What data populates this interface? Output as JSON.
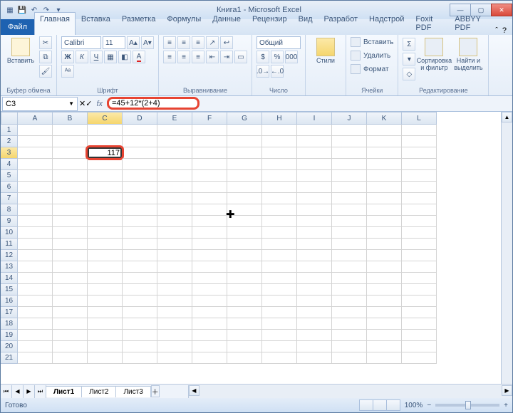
{
  "title": "Книга1 - Microsoft Excel",
  "tabs": {
    "file": "Файл",
    "items": [
      "Главная",
      "Вставка",
      "Разметка",
      "Формулы",
      "Данные",
      "Рецензир",
      "Вид",
      "Разработ",
      "Надстрой",
      "Foxit PDF",
      "ABBYY PDF"
    ],
    "activeIndex": 0
  },
  "ribbon": {
    "clipboard": {
      "paste": "Вставить",
      "label": "Буфер обмена"
    },
    "font": {
      "name": "Calibri",
      "size": "11",
      "label": "Шрифт"
    },
    "align": {
      "label": "Выравнивание"
    },
    "number": {
      "format": "Общий",
      "label": "Число"
    },
    "styles": {
      "btn": "Стили",
      "label": ""
    },
    "cells": {
      "insert": "Вставить",
      "delete": "Удалить",
      "format": "Формат",
      "label": "Ячейки"
    },
    "editing": {
      "sort": "Сортировка\nи фильтр",
      "find": "Найти и\nвыделить",
      "label": "Редактирование"
    }
  },
  "namebox": "C3",
  "formula": "=45+12*(2+4)",
  "active_cell_value": "117",
  "columns": [
    "A",
    "B",
    "C",
    "D",
    "E",
    "F",
    "G",
    "H",
    "I",
    "J",
    "K",
    "L"
  ],
  "selectedCol": "C",
  "selectedRow": 3,
  "rowCount": 21,
  "sheets": [
    "Лист1",
    "Лист2",
    "Лист3"
  ],
  "activeSheet": 0,
  "status": {
    "ready": "Готово",
    "zoom": "100%"
  }
}
